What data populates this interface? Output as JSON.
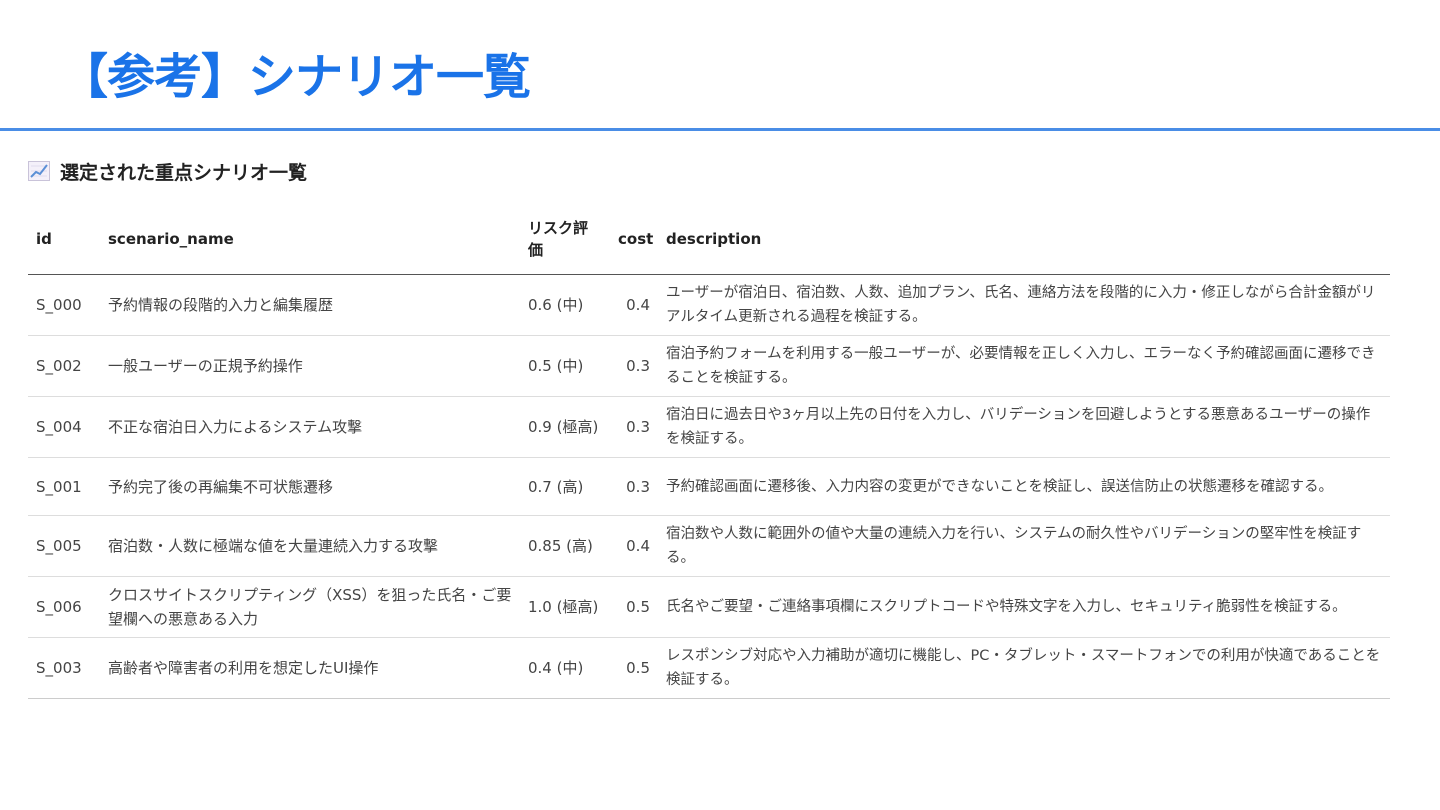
{
  "title": "【参考】シナリオ一覧",
  "section": {
    "heading": "選定された重点シナリオ一覧",
    "icon": "chart-increasing-icon"
  },
  "colors": {
    "title": "#1a73e8",
    "rule": "#4a8de6"
  },
  "table": {
    "headers": {
      "id": "id",
      "scenario_name": "scenario_name",
      "risk": "リスク評価",
      "cost": "cost",
      "description": "description"
    },
    "rows": [
      {
        "id": "S_000",
        "scenario_name": "予約情報の段階的入力と編集履歴",
        "risk": "0.6 (中)",
        "cost": "0.4",
        "description": "ユーザーが宿泊日、宿泊数、人数、追加プラン、氏名、連絡方法を段階的に入力・修正しながら合計金額がリアルタイム更新される過程を検証する。"
      },
      {
        "id": "S_002",
        "scenario_name": "一般ユーザーの正規予約操作",
        "risk": "0.5 (中)",
        "cost": "0.3",
        "description": "宿泊予約フォームを利用する一般ユーザーが、必要情報を正しく入力し、エラーなく予約確認画面に遷移できることを検証する。"
      },
      {
        "id": "S_004",
        "scenario_name": "不正な宿泊日入力によるシステム攻撃",
        "risk": "0.9 (極高)",
        "cost": "0.3",
        "description": "宿泊日に過去日や3ヶ月以上先の日付を入力し、バリデーションを回避しようとする悪意あるユーザーの操作を検証する。"
      },
      {
        "id": "S_001",
        "scenario_name": "予約完了後の再編集不可状態遷移",
        "risk": "0.7 (高)",
        "cost": "0.3",
        "description": "予約確認画面に遷移後、入力内容の変更ができないことを検証し、誤送信防止の状態遷移を確認する。"
      },
      {
        "id": "S_005",
        "scenario_name": "宿泊数・人数に極端な値を大量連続入力する攻撃",
        "risk": "0.85 (高)",
        "cost": "0.4",
        "description": "宿泊数や人数に範囲外の値や大量の連続入力を行い、システムの耐久性やバリデーションの堅牢性を検証する。"
      },
      {
        "id": "S_006",
        "scenario_name": "クロスサイトスクリプティング（XSS）を狙った氏名・ご要望欄への悪意ある入力",
        "risk": "1.0 (極高)",
        "cost": "0.5",
        "description": "氏名やご要望・ご連絡事項欄にスクリプトコードや特殊文字を入力し、セキュリティ脆弱性を検証する。"
      },
      {
        "id": "S_003",
        "scenario_name": "高齢者や障害者の利用を想定したUI操作",
        "risk": "0.4 (中)",
        "cost": "0.5",
        "description": "レスポンシブ対応や入力補助が適切に機能し、PC・タブレット・スマートフォンでの利用が快適であることを検証する。"
      }
    ]
  }
}
